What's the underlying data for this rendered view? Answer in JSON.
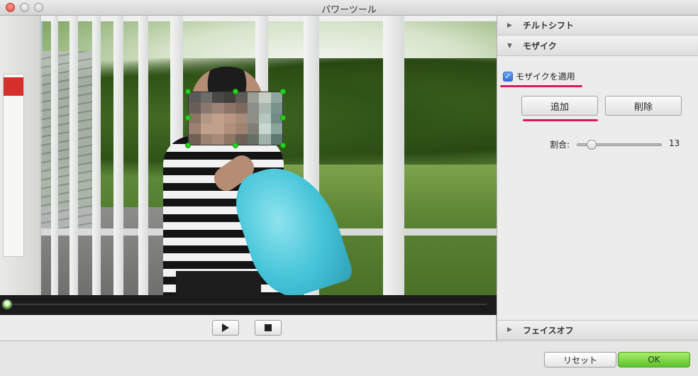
{
  "window": {
    "title": "パワーツール"
  },
  "preview": {
    "mosaic_colors": [
      "#5b5a58",
      "#6e6d6a",
      "#4a4846",
      "#3f3e3b",
      "#5e5b57",
      "#9a9e96",
      "#c5d0c2",
      "#8fa59e",
      "#6a5f58",
      "#8a776d",
      "#9b8476",
      "#8c7466",
      "#7d6a5d",
      "#8c8f8a",
      "#a9b7b0",
      "#7a938a",
      "#8a7466",
      "#b29887",
      "#c2a08b",
      "#b79683",
      "#a88b79",
      "#8e8e86",
      "#b6c7c1",
      "#6f8b83",
      "#9b8170",
      "#c0a08b",
      "#bfa08a",
      "#b08f7c",
      "#9f8472",
      "#7f7f78",
      "#c9d6d1",
      "#8ca49b",
      "#6f5f55",
      "#9c8070",
      "#a78a78",
      "#8f7563",
      "#6f6055",
      "#667066",
      "#9fb2aa",
      "#5e776f"
    ],
    "mosaic_color_note": "cell colors of pixelated mosaic region",
    "progress": 0.0
  },
  "controls": {
    "play_icon": "play-icon",
    "stop_icon": "stop-icon"
  },
  "panel": {
    "sections": [
      {
        "label": "チルトシフト",
        "expanded": false
      },
      {
        "label": "モザイク",
        "expanded": true
      },
      {
        "label": "フェイスオフ",
        "expanded": false
      }
    ],
    "mosaic": {
      "apply_label": "モザイクを適用",
      "apply_checked": true,
      "add_label": "追加",
      "delete_label": "削除",
      "ratio_label": "割合:",
      "ratio_value": "13",
      "ratio_fraction": 0.13
    }
  },
  "footer": {
    "reset_label": "リセット",
    "ok_label": "OK"
  },
  "colors": {
    "highlight": "#e0185a",
    "ok_button": "#5cc32b",
    "handle": "#27d51f"
  }
}
